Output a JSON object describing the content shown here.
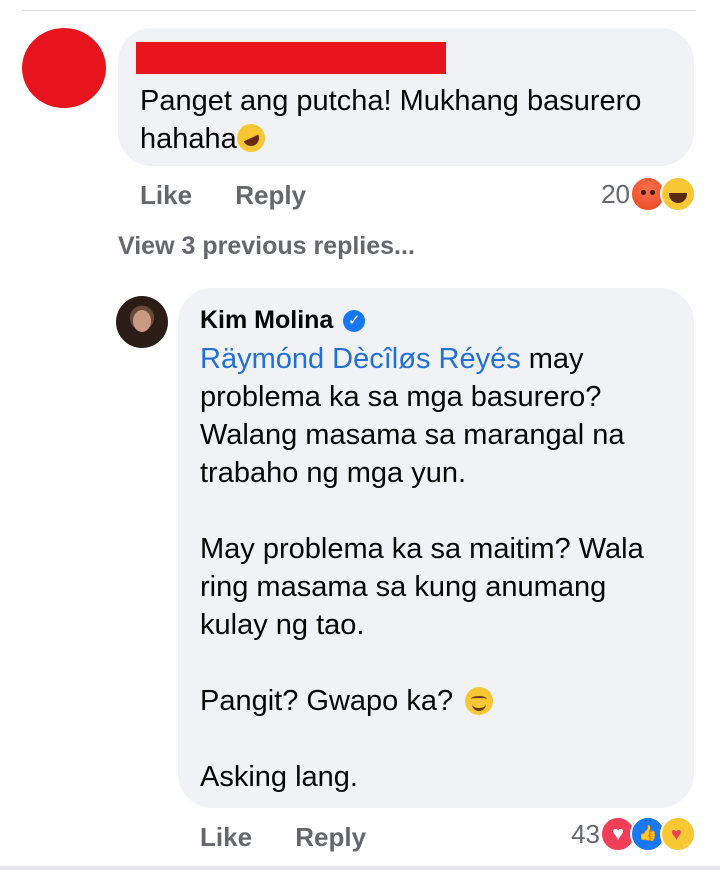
{
  "comment1": {
    "text": "Panget ang putcha! Mukhang basurero hahaha",
    "emoji_icon": "rolling-on-floor-laughing-icon",
    "actions": {
      "like": "Like",
      "reply": "Reply"
    },
    "reaction_count": "20",
    "reactions": [
      "angry-icon",
      "laugh-icon"
    ]
  },
  "view_previous": "View 3 previous replies...",
  "reply": {
    "author": "Kim Molina",
    "verified": true,
    "mention": "Räymónd Dècîløs Réyés",
    "paragraphs": [
      " may problema ka sa mga basurero? Walang masama sa marangal na trabaho ng mga yun.",
      "May problema ka sa maitim? Wala ring masama sa kung anumang kulay ng tao.",
      "Pangit? Gwapo ka? ",
      "Asking lang."
    ],
    "actions": {
      "like": "Like",
      "reply": "Reply"
    },
    "reaction_count": "43",
    "reactions": [
      "love-icon",
      "like-icon",
      "care-icon"
    ]
  },
  "colors": {
    "bubble": "#f0f2f5",
    "mention": "#216fdb",
    "secondary_text": "#65676b",
    "redaction": "#e8141d"
  }
}
